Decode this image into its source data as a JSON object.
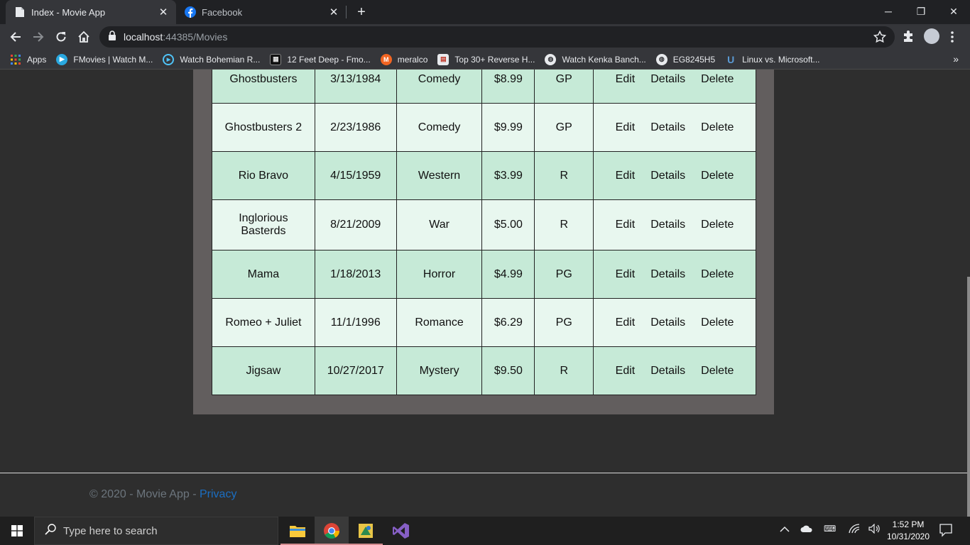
{
  "browser": {
    "tabs": [
      {
        "title": "Index - Movie App",
        "active": true,
        "icon": "document-icon"
      },
      {
        "title": "Facebook",
        "active": false,
        "icon": "facebook-icon"
      }
    ],
    "new_tab": "+",
    "window_controls": {
      "minimize": "─",
      "restore": "❐",
      "close": "✕"
    },
    "url_host": "localhost",
    "url_rest": ":44385/Movies"
  },
  "bookmarks": [
    {
      "label": "Apps",
      "icon": "apps-grid-icon"
    },
    {
      "label": "FMovies | Watch M...",
      "icon": "fmovies-icon"
    },
    {
      "label": "Watch Bohemian R...",
      "icon": "play-circle-icon"
    },
    {
      "label": "12 Feet Deep - Fmo...",
      "icon": "film-icon"
    },
    {
      "label": "meralco",
      "icon": "meralco-icon"
    },
    {
      "label": "Top 30+ Reverse H...",
      "icon": "site-icon"
    },
    {
      "label": "Watch Kenka Banch...",
      "icon": "globe-icon"
    },
    {
      "label": "EG8245H5",
      "icon": "globe-icon"
    },
    {
      "label": "Linux vs. Microsoft...",
      "icon": "shield-icon"
    }
  ],
  "bookmarks_more": "»",
  "movies": [
    {
      "title": "Ghostbusters",
      "date": "3/13/1984",
      "genre": "Comedy",
      "price": "$8.99",
      "rating": "GP"
    },
    {
      "title": "Ghostbusters 2",
      "date": "2/23/1986",
      "genre": "Comedy",
      "price": "$9.99",
      "rating": "GP"
    },
    {
      "title": "Rio Bravo",
      "date": "4/15/1959",
      "genre": "Western",
      "price": "$3.99",
      "rating": "R"
    },
    {
      "title": "Inglorious Basterds",
      "date": "8/21/2009",
      "genre": "War",
      "price": "$5.00",
      "rating": "R"
    },
    {
      "title": "Mama",
      "date": "1/18/2013",
      "genre": "Horror",
      "price": "$4.99",
      "rating": "PG"
    },
    {
      "title": "Romeo + Juliet",
      "date": "11/1/1996",
      "genre": "Romance",
      "price": "$6.29",
      "rating": "PG"
    },
    {
      "title": "Jigsaw",
      "date": "10/27/2017",
      "genre": "Mystery",
      "price": "$9.50",
      "rating": "R"
    }
  ],
  "actions": {
    "edit": "Edit",
    "details": "Details",
    "delete": "Delete"
  },
  "footer": {
    "copyright": "© 2020 - Movie App - ",
    "privacy": "Privacy"
  },
  "taskbar": {
    "search_placeholder": "Type here to search",
    "time": "1:52 PM",
    "date": "10/31/2020"
  }
}
